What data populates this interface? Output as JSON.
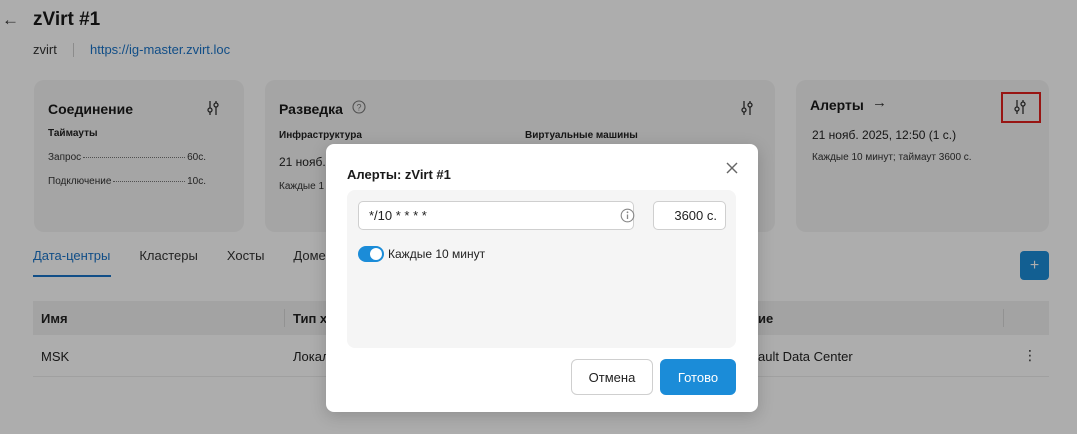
{
  "header": {
    "title": "zVirt #1",
    "type": "zvirt",
    "url": "https://ig-master.zvirt.loc"
  },
  "cards": {
    "connection": {
      "title": "Соединение",
      "timeouts_label": "Таймауты",
      "rows": [
        {
          "label": "Запрос",
          "value": "60с."
        },
        {
          "label": "Подключение",
          "value": "10с."
        }
      ]
    },
    "discovery": {
      "title": "Разведка",
      "infra_label": "Инфраструктура",
      "vm_label": "Виртуальные машины",
      "infra_date": "21 нояб.",
      "infra_schedule": "Каждые 1"
    },
    "alerts": {
      "title": "Алерты",
      "date": "21 нояб. 2025, 12:50 (1 с.)",
      "schedule": "Каждые 10 минут; таймаут 3600 с."
    }
  },
  "tabs": [
    {
      "label": "Дата-центры",
      "active": true
    },
    {
      "label": "Кластеры",
      "active": false
    },
    {
      "label": "Хосты",
      "active": false
    },
    {
      "label": "Доме",
      "active": false
    }
  ],
  "add_button_label": "+",
  "table": {
    "columns": [
      "Имя",
      "Тип х",
      "ие"
    ],
    "rows": [
      {
        "name": "MSK",
        "type": "Локал",
        "desc": "ault Data Center"
      }
    ]
  },
  "modal": {
    "title": "Алерты: zVirt #1",
    "cron_value": "*/10 * * * *",
    "timeout_value": "3600 с.",
    "toggle_label": "Каждые 10 минут",
    "toggle_on": true,
    "cancel_label": "Отмена",
    "ok_label": "Готово"
  },
  "colors": {
    "accent": "#1b8cd8",
    "link": "#1a73c8",
    "highlight": "#e0201c"
  }
}
